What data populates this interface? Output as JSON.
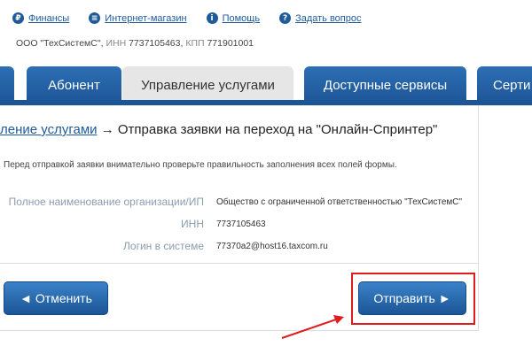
{
  "top_links": [
    {
      "icon": "ruble-icon",
      "glyph": "₽",
      "label": "Финансы"
    },
    {
      "icon": "cart-icon",
      "glyph": "≡",
      "label": "Интернет-магазин"
    },
    {
      "icon": "info-icon",
      "glyph": "i",
      "label": "Помощь"
    },
    {
      "icon": "question-icon",
      "glyph": "?",
      "label": "Задать вопрос"
    }
  ],
  "org": {
    "name": "ООО \"ТехСистемС\",",
    "inn_label": "ИНН",
    "inn": "7737105463,",
    "kpp_label": "КПП",
    "kpp": "771901001"
  },
  "tabs": [
    {
      "label": ""
    },
    {
      "label": "Абонент"
    },
    {
      "label": "Управление услугами"
    },
    {
      "label": "Доступные сервисы"
    },
    {
      "label": "Серти"
    }
  ],
  "breadcrumb": {
    "link": "ление услугами",
    "arrow": " → ",
    "current": "Отправка заявки на переход на \"Онлайн-Спринтер\""
  },
  "note": "Перед отправкой заявки внимательно проверьте правильность заполнения всех полей формы.",
  "fields": [
    {
      "label": "Полное наименование организации/ИП",
      "value": "Общество с ограниченной ответственностью \"ТехСистемС\""
    },
    {
      "label": "ИНН",
      "value": "7737105463"
    },
    {
      "label": "Логин в системе",
      "value": "77370a2@host16.taxcom.ru"
    }
  ],
  "buttons": {
    "cancel": "◄ Отменить",
    "send": "Отправить ►"
  },
  "colors": {
    "accent": "#1f5a99",
    "highlight": "#e01b1b"
  }
}
